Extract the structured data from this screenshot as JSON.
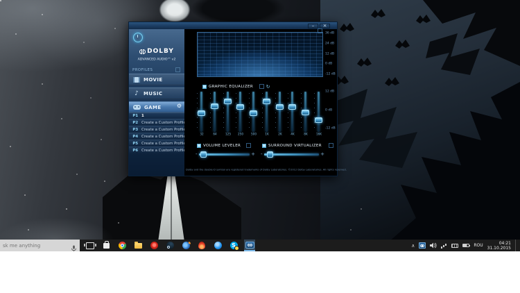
{
  "window": {
    "titlebar": {
      "minimize_label": "–",
      "close_label": "×"
    },
    "sidebar": {
      "brand_name": "DOLBY",
      "brand_sub": "ADVANCED AUDIO™ v2",
      "profiles_header": "PROFILES",
      "profiles": [
        {
          "id": "movie",
          "label": "MOVIE",
          "icon": "film-icon",
          "selected": false
        },
        {
          "id": "music",
          "label": "MUSIC",
          "icon": "music-note-icon",
          "selected": false
        },
        {
          "id": "game",
          "label": "GAME",
          "icon": "gamepad-icon",
          "selected": true
        }
      ],
      "custom_profiles": [
        {
          "key": "P1",
          "label": "1"
        },
        {
          "key": "P2",
          "label": "Create a Custom Profile"
        },
        {
          "key": "P3",
          "label": "Create a Custom Profile"
        },
        {
          "key": "P4",
          "label": "Create a Custom Profile"
        },
        {
          "key": "P5",
          "label": "Create a Custom Profile"
        },
        {
          "key": "P6",
          "label": "Create a Custom Profile"
        }
      ]
    },
    "spectrum": {
      "db_labels": [
        "36 dB",
        "24 dB",
        "12 dB",
        "0 dB",
        "-12 dB"
      ]
    },
    "equalizer": {
      "title": "GRAPHIC EQUALIZER",
      "db_labels": [
        "12 dB",
        "0 dB",
        "-12 dB"
      ],
      "bands": [
        {
          "freq": "32",
          "level_pct": 53
        },
        {
          "freq": "64",
          "level_pct": 37
        },
        {
          "freq": "125",
          "level_pct": 24
        },
        {
          "freq": "250",
          "level_pct": 38
        },
        {
          "freq": "500",
          "level_pct": 53
        },
        {
          "freq": "1K",
          "level_pct": 24
        },
        {
          "freq": "2K",
          "level_pct": 38
        },
        {
          "freq": "4K",
          "level_pct": 38
        },
        {
          "freq": "8K",
          "level_pct": 51
        },
        {
          "freq": "16K",
          "level_pct": 70
        }
      ]
    },
    "volume_leveler": {
      "title": "VOLUME LEVELER",
      "minus": "-",
      "plus": "+",
      "level_pct": 4
    },
    "surround_virtualizer": {
      "title": "SURROUND VIRTUALIZER",
      "minus": "-",
      "plus": "+",
      "level_pct": 5
    },
    "footer_text": "Dolby and the double-D symbol are registered trademarks of Dolby Laboratories. ©2012 Dolby Laboratories. All rights reserved."
  },
  "taskbar": {
    "search_text": "sk me anything",
    "app_icons": [
      "task-view",
      "store",
      "chrome",
      "file-explorer",
      "red-app",
      "steam",
      "firefox",
      "flame-app",
      "blue-app",
      "skype",
      "dolby"
    ],
    "tray": {
      "language": "ROU",
      "time": "04:21",
      "date": "31.10.2015"
    }
  },
  "colors": {
    "accent": "#4aa3d8",
    "eq_handle": "#5ab4e4",
    "taskbar": "#1c1c1c",
    "selected_item": "#4a7aae"
  }
}
